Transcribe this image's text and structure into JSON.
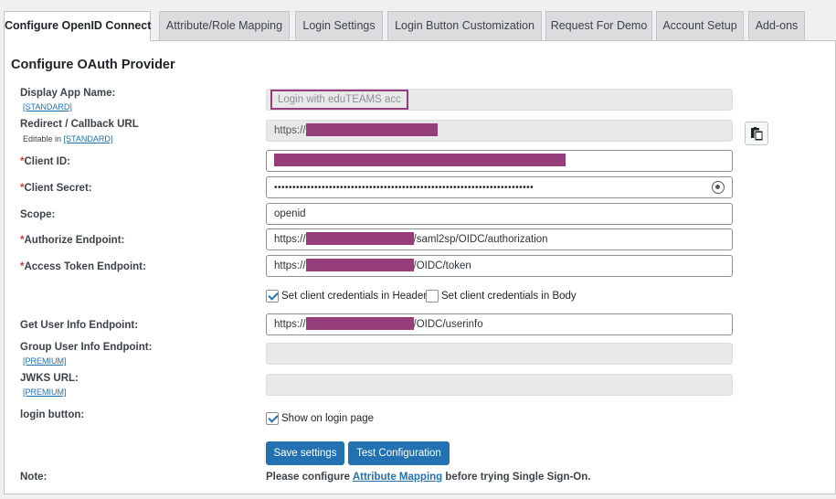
{
  "tabs": [
    {
      "label": "Configure OpenID Connect",
      "active": true
    },
    {
      "label": "Attribute/Role Mapping"
    },
    {
      "label": "Login Settings"
    },
    {
      "label": "Login Button Customization"
    },
    {
      "label": "Request For Demo"
    },
    {
      "label": "Account Setup"
    },
    {
      "label": "Add-ons"
    }
  ],
  "heading": "Configure OAuth Provider",
  "fields": {
    "display_app_name": {
      "label": "Display App Name:",
      "tag": "[STANDARD]",
      "value": "Login with eduTEAMS acc"
    },
    "redirect_url": {
      "label": "Redirect / Callback URL",
      "editable_prefix": "Editable in ",
      "tag": "[STANDARD]",
      "value_prefix": "https://"
    },
    "client_id": {
      "label": "Client ID:",
      "required": "*"
    },
    "client_secret": {
      "label": "Client Secret:",
      "required": "*",
      "masked": "•••••••••••••••••••••••••••••••••••••••••••••••••••••••••••••••••••••••"
    },
    "scope": {
      "label": "Scope:",
      "value": "openid"
    },
    "authorize_endpoint": {
      "label": "Authorize Endpoint:",
      "required": "*",
      "prefix": "https://",
      "suffix": "/saml2sp/OIDC/authorization"
    },
    "access_token_endpoint": {
      "label": "Access Token Endpoint:",
      "required": "*",
      "prefix": "https://",
      "suffix": "/OIDC/token"
    },
    "user_info_endpoint": {
      "label": "Get User Info Endpoint:",
      "prefix": "https://",
      "suffix": "/OIDC/userinfo"
    },
    "group_user_info_endpoint": {
      "label": "Group User Info Endpoint:",
      "tag": "[PREMIUM]"
    },
    "jwks_url": {
      "label": "JWKS URL:",
      "tag": "[PREMIUM]"
    },
    "login_button": {
      "label": "login button:"
    }
  },
  "checkboxes": {
    "credentials_header": {
      "label": "Set client credentials in Header",
      "checked": true
    },
    "credentials_body": {
      "label": "Set client credentials in Body",
      "checked": false
    },
    "show_on_login": {
      "label": "Show on login page",
      "checked": true
    }
  },
  "buttons": {
    "save": "Save settings",
    "test": "Test Configuration"
  },
  "note": {
    "label": "Note:",
    "before": "Please configure ",
    "link": "Attribute Mapping",
    "after": " before trying Single Sign-On."
  },
  "colors": {
    "accent": "#2271b1",
    "redaction": "#953e79",
    "required": "#d63638"
  },
  "icons": {
    "copy": "clipboard-icon",
    "show_password": "eye-icon"
  }
}
